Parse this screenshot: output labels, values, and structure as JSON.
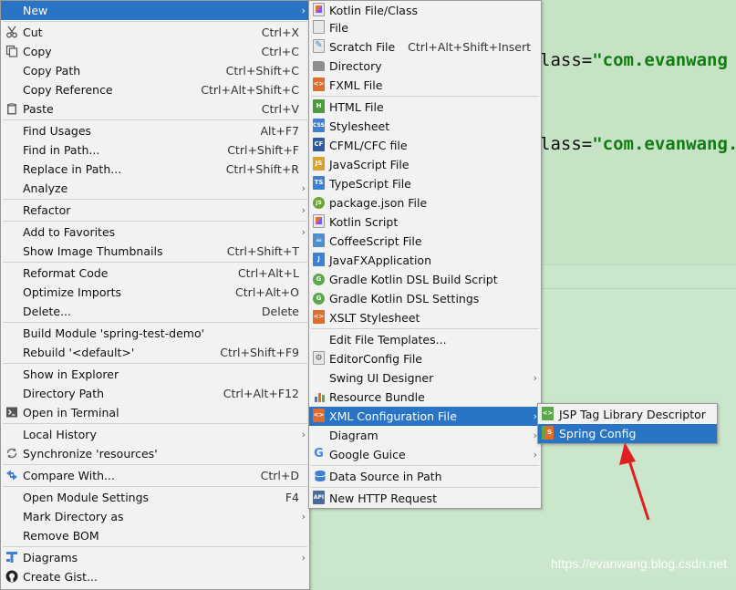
{
  "editor": {
    "line1_prefix": "lass=",
    "line1_value": "\"com.evanwang",
    "line2_prefix": "lass=",
    "line2_value": "\"com.evanwang.s"
  },
  "watermark": "https://evanwang.blog.csdn.net",
  "main_menu": [
    {
      "label": "New",
      "shortcut": "",
      "submenu": true,
      "icon": "",
      "selected": true
    },
    {
      "label": "Cut",
      "shortcut": "Ctrl+X",
      "icon": "scissors-icon"
    },
    {
      "label": "Copy",
      "shortcut": "Ctrl+C",
      "icon": "copy-icon"
    },
    {
      "label": "Copy Path",
      "shortcut": "Ctrl+Shift+C"
    },
    {
      "label": "Copy Reference",
      "shortcut": "Ctrl+Alt+Shift+C"
    },
    {
      "label": "Paste",
      "shortcut": "Ctrl+V",
      "icon": "clipboard-icon"
    },
    {
      "label": "Find Usages",
      "shortcut": "Alt+F7"
    },
    {
      "label": "Find in Path...",
      "shortcut": "Ctrl+Shift+F"
    },
    {
      "label": "Replace in Path...",
      "shortcut": "Ctrl+Shift+R"
    },
    {
      "label": "Analyze",
      "submenu": true
    },
    {
      "label": "Refactor",
      "submenu": true
    },
    {
      "label": "Add to Favorites",
      "submenu": true
    },
    {
      "label": "Show Image Thumbnails",
      "shortcut": "Ctrl+Shift+T"
    },
    {
      "label": "Reformat Code",
      "shortcut": "Ctrl+Alt+L"
    },
    {
      "label": "Optimize Imports",
      "shortcut": "Ctrl+Alt+O"
    },
    {
      "label": "Delete...",
      "shortcut": "Delete"
    },
    {
      "label": "Build Module 'spring-test-demo'"
    },
    {
      "label": "Rebuild '<default>'",
      "shortcut": "Ctrl+Shift+F9"
    },
    {
      "label": "Show in Explorer"
    },
    {
      "label": "Directory Path",
      "shortcut": "Ctrl+Alt+F12"
    },
    {
      "label": "Open in Terminal",
      "icon": "terminal-icon"
    },
    {
      "label": "Local History",
      "submenu": true
    },
    {
      "label": "Synchronize 'resources'",
      "icon": "sync-icon"
    },
    {
      "label": "Compare With...",
      "shortcut": "Ctrl+D",
      "icon": "compare-icon"
    },
    {
      "label": "Open Module Settings",
      "shortcut": "F4"
    },
    {
      "label": "Mark Directory as",
      "submenu": true
    },
    {
      "label": "Remove BOM"
    },
    {
      "label": "Diagrams",
      "submenu": true,
      "icon": "diagram-icon"
    },
    {
      "label": "Create Gist...",
      "icon": "github-icon"
    }
  ],
  "new_menu": [
    {
      "label": "Kotlin File/Class",
      "icon": "kotlin-file-icon"
    },
    {
      "label": "File",
      "icon": "file-icon"
    },
    {
      "label": "Scratch File",
      "shortcut": "Ctrl+Alt+Shift+Insert",
      "icon": "scratch-file-icon"
    },
    {
      "label": "Directory",
      "icon": "folder-icon"
    },
    {
      "label": "FXML File",
      "icon": "fxml-file-icon"
    },
    {
      "label": "HTML File",
      "icon": "html-file-icon"
    },
    {
      "label": "Stylesheet",
      "icon": "css-file-icon"
    },
    {
      "label": "CFML/CFC file",
      "icon": "cfml-file-icon"
    },
    {
      "label": "JavaScript File",
      "icon": "js-file-icon"
    },
    {
      "label": "TypeScript File",
      "icon": "ts-file-icon"
    },
    {
      "label": "package.json File",
      "icon": "nodejs-icon"
    },
    {
      "label": "Kotlin Script",
      "icon": "kotlin-script-icon"
    },
    {
      "label": "CoffeeScript File",
      "icon": "coffeescript-icon"
    },
    {
      "label": "JavaFXApplication",
      "icon": "javafx-icon"
    },
    {
      "label": "Gradle Kotlin DSL Build Script",
      "icon": "gradle-icon"
    },
    {
      "label": "Gradle Kotlin DSL Settings",
      "icon": "gradle-icon"
    },
    {
      "label": "XSLT Stylesheet",
      "icon": "xslt-icon"
    },
    {
      "label": "Edit File Templates..."
    },
    {
      "label": "EditorConfig File",
      "icon": "editorconfig-icon"
    },
    {
      "label": "Swing UI Designer",
      "submenu": true
    },
    {
      "label": "Resource Bundle",
      "icon": "resource-bundle-icon"
    },
    {
      "label": "XML Configuration File",
      "submenu": true,
      "icon": "xml-file-icon",
      "selected": true
    },
    {
      "label": "Diagram",
      "submenu": true
    },
    {
      "label": "Google Guice",
      "submenu": true,
      "icon": "google-icon"
    },
    {
      "label": "Data Source in Path",
      "icon": "database-icon"
    },
    {
      "label": "New HTTP Request",
      "icon": "api-icon"
    }
  ],
  "xml_menu": [
    {
      "label": "JSP Tag Library Descriptor",
      "icon": "jsp-tld-icon"
    },
    {
      "label": "Spring Config",
      "icon": "spring-config-icon",
      "selected": true
    }
  ],
  "arrow_glyph": "›",
  "icon_text": {
    "fxml": "<>",
    "html": "H",
    "css": "CSS",
    "cfml": "CF",
    "js": "JS",
    "ts": "TS",
    "nodejs": "JS",
    "javafx": "J",
    "gradle": "G",
    "xslt": "<>",
    "xml": "<>",
    "google": "G",
    "api": "API",
    "kotlin": "K",
    "spring": "S",
    "tld": "<>"
  }
}
